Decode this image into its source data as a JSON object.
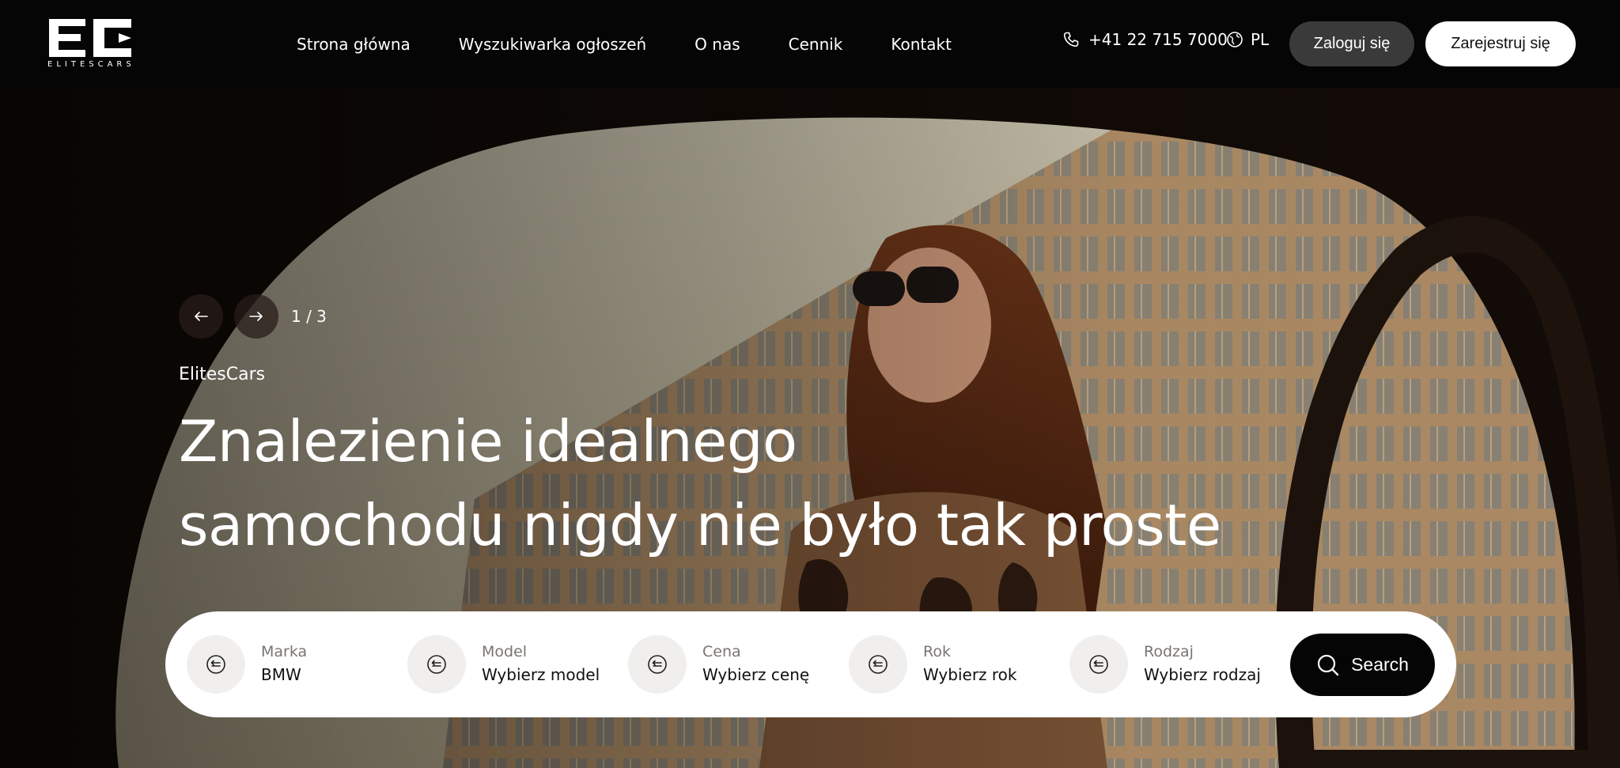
{
  "brand": {
    "logo_text": "ELITESCARS"
  },
  "nav": {
    "items": [
      {
        "label": "Strona główna"
      },
      {
        "label": "Wyszukiwarka ogłoszeń"
      },
      {
        "label": "O nas"
      },
      {
        "label": "Cennik"
      },
      {
        "label": "Kontakt"
      }
    ]
  },
  "header": {
    "phone": "+41 22 715 7000",
    "phone_icon": "phone-icon",
    "language": "PL",
    "language_icon": "globe-icon",
    "login_label": "Zaloguj się",
    "register_label": "Zarejestruj się"
  },
  "hero": {
    "slide_counter": "1 / 3",
    "prev_icon": "arrow-left-icon",
    "next_icon": "arrow-right-icon",
    "eyebrow": "ElitesCars",
    "headline_line1": "Znalezienie idealnego",
    "headline_line2": "samochodu nigdy nie było tak proste"
  },
  "search": {
    "fields": [
      {
        "label": "Marka",
        "value": "BMW",
        "icon": "swap-icon"
      },
      {
        "label": "Model",
        "value": "Wybierz model",
        "icon": "swap-icon"
      },
      {
        "label": "Cena",
        "value": "Wybierz cenę",
        "icon": "swap-icon"
      },
      {
        "label": "Rok",
        "value": "Wybierz rok",
        "icon": "swap-icon"
      },
      {
        "label": "Rodzaj",
        "value": "Wybierz rodzaj",
        "icon": "swap-icon"
      }
    ],
    "button_label": "Search",
    "button_icon": "search-icon"
  },
  "colors": {
    "header_bg": "#050505",
    "login_bg": "#3a3a3a",
    "register_bg": "#ffffff",
    "search_button_bg": "#050505",
    "field_icon_bg": "#f0efed"
  }
}
